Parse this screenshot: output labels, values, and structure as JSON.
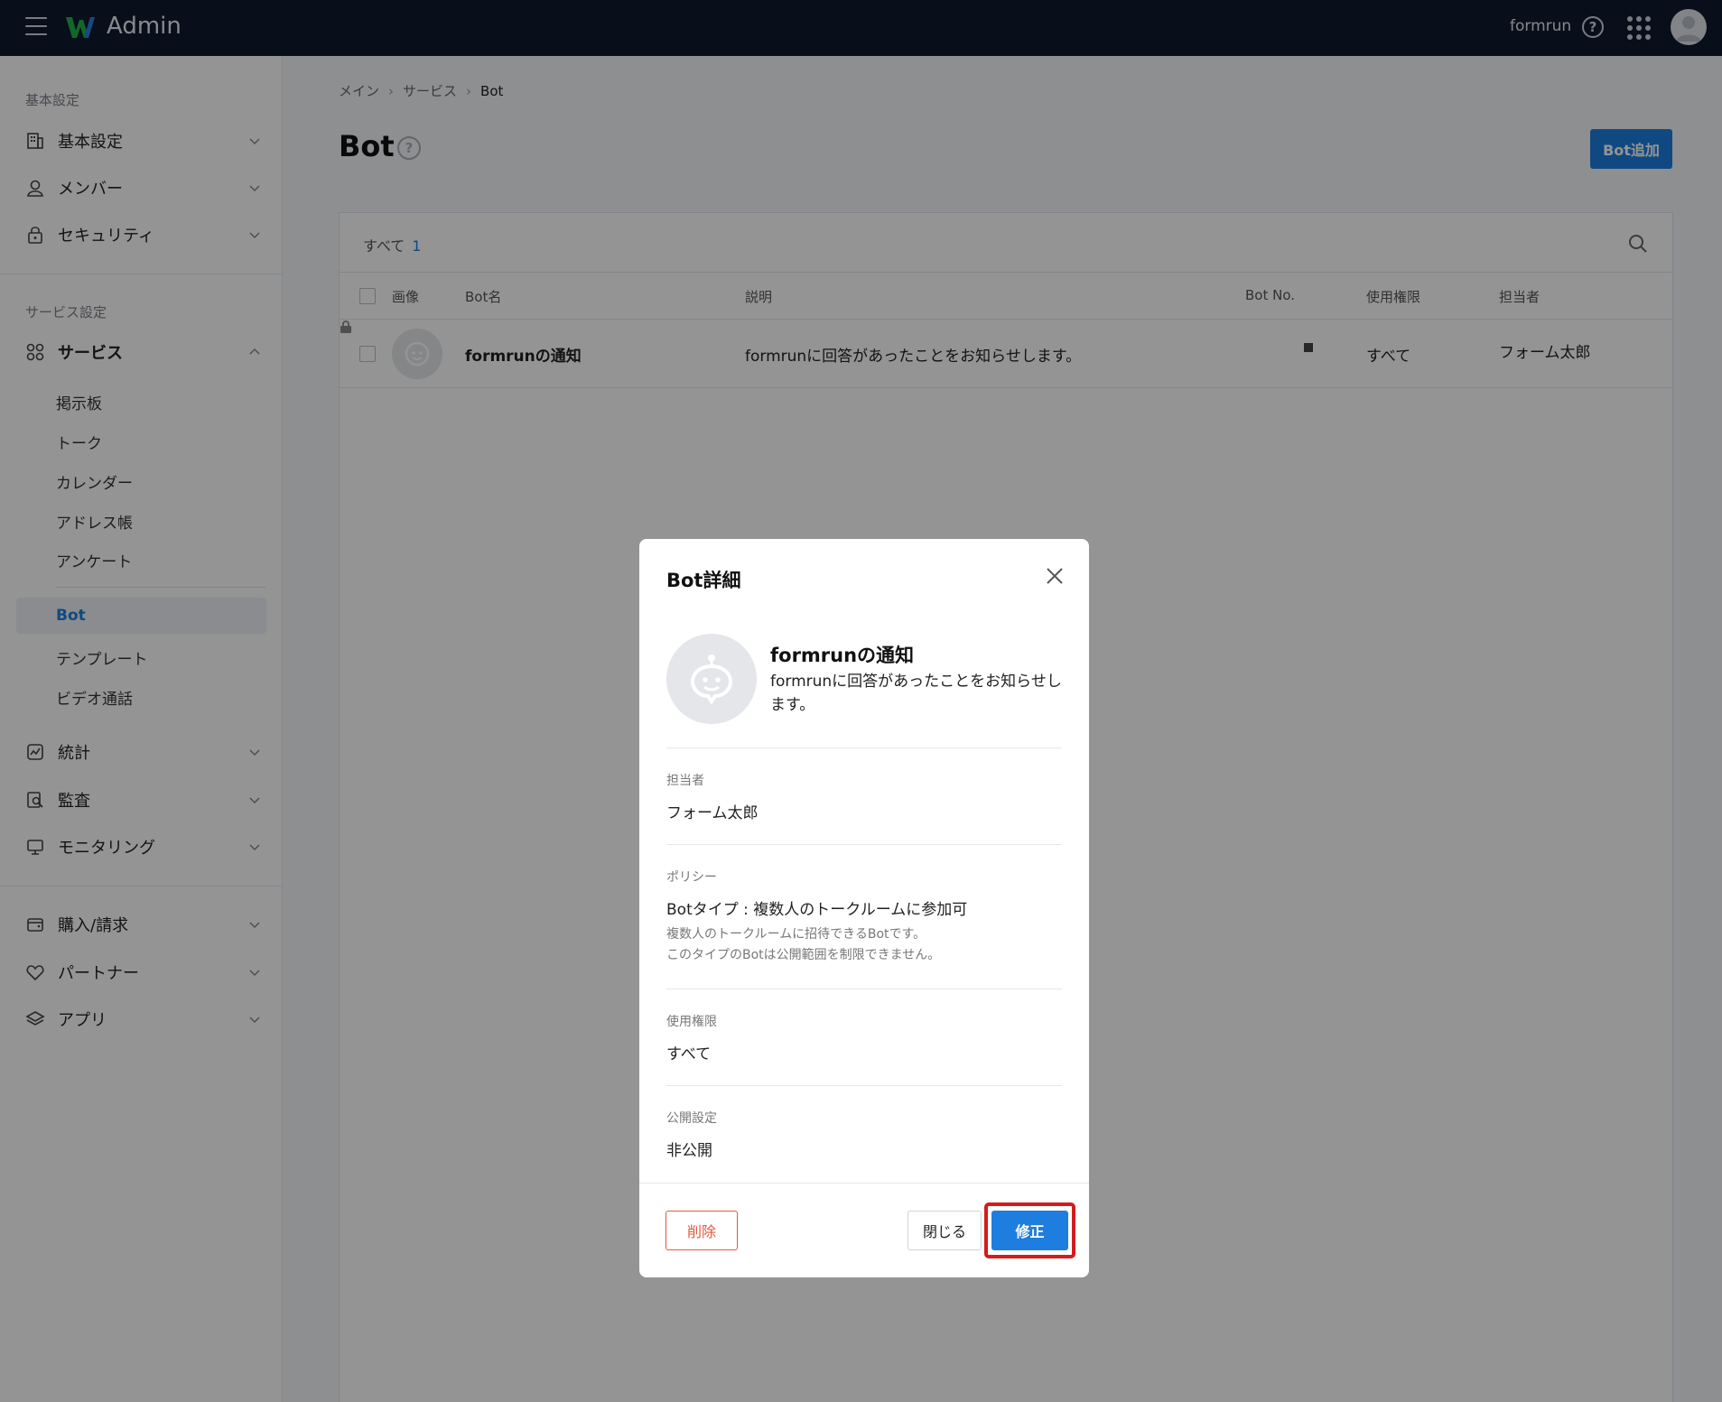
{
  "topbar": {
    "brand": "Admin",
    "user_name": "formrun",
    "help_glyph": "?"
  },
  "sidebar": {
    "basic_section": "基本設定",
    "basic_items": [
      {
        "label": "基本設定",
        "icon": "building-icon"
      },
      {
        "label": "メンバー",
        "icon": "member-icon"
      },
      {
        "label": "セキュリティ",
        "icon": "lock-icon"
      }
    ],
    "service_section": "サービス設定",
    "service_group": {
      "label": "サービス",
      "icon": "grid-icon"
    },
    "service_subitems": [
      "掲示板",
      "トーク",
      "カレンダー",
      "アドレス帳",
      "アンケート"
    ],
    "service_subitems2": [
      "Bot",
      "テンプレート",
      "ビデオ通話"
    ],
    "active_subitem": "Bot",
    "other_items": [
      {
        "label": "統計",
        "icon": "chart-icon"
      },
      {
        "label": "監査",
        "icon": "audit-icon"
      },
      {
        "label": "モニタリング",
        "icon": "monitor-icon"
      }
    ],
    "bottom_items": [
      {
        "label": "購入/請求",
        "icon": "wallet-icon"
      },
      {
        "label": "パートナー",
        "icon": "partner-icon"
      },
      {
        "label": "アプリ",
        "icon": "layers-icon"
      }
    ]
  },
  "breadcrumb": [
    "メイン",
    "サービス",
    "Bot"
  ],
  "page": {
    "title": "Bot",
    "help_glyph": "?",
    "add_button": "Bot追加"
  },
  "table": {
    "filter_label": "すべて",
    "count": "1",
    "headers": {
      "image": "画像",
      "name": "Bot名",
      "description": "説明",
      "bot_no": "Bot No.",
      "permission": "使用権限",
      "owner": "担当者"
    },
    "rows": [
      {
        "name": "formrunの通知",
        "description": "formrunに回答があったことをお知らせします。",
        "permission": "すべて",
        "owner": "フォーム太郎"
      }
    ]
  },
  "modal": {
    "title": "Bot詳細",
    "bot_name": "formrunの通知",
    "bot_description": "formrunに回答があったことをお知らせします。",
    "owner_label": "担当者",
    "owner_value": "フォーム太郎",
    "policy_label": "ポリシー",
    "policy_value": "Botタイプ : 複数人のトークルームに参加可",
    "policy_note_1": "複数人のトークルームに招待できるBotです。",
    "policy_note_2": "このタイプのBotは公開範囲を制限できません。",
    "permission_label": "使用権限",
    "permission_value": "すべて",
    "visibility_label": "公開設定",
    "visibility_value": "非公開",
    "delete_button": "削除",
    "close_button": "閉じる",
    "edit_button": "修正"
  },
  "colors": {
    "topbar": "#0e1a2e",
    "accent": "#1d7ee0",
    "danger": "#e2593a",
    "highlight_outline": "#d31c1c"
  }
}
